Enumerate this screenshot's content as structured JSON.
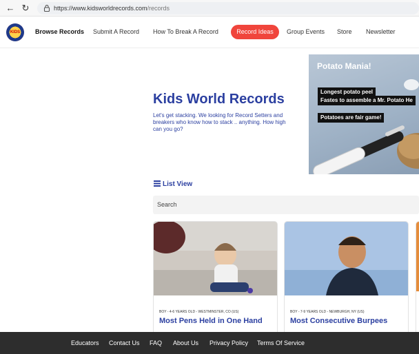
{
  "browser": {
    "url_host": "https://www.kidsworldrecords.com",
    "url_path": "/records"
  },
  "header": {
    "logo_text": "KIDS",
    "nav": [
      "Browse Records",
      "Submit A Record",
      "How To Break A Record",
      "Record Ideas",
      "Group Events",
      "Store",
      "Newsletter"
    ],
    "accent_color": "#f0453c"
  },
  "hero": {
    "title": "Kids World Records",
    "subtitle": "Let's get stacking. We looking for Record Setters and breakers who know how to stack .. anything. How high can you go?",
    "image": {
      "title": "Potato Mania!",
      "captions": [
        "Longest potato peel",
        "Fastes to assemble a Mr. Potato He",
        "Potatoes are fair game!"
      ]
    }
  },
  "list_view": {
    "label": "List View"
  },
  "search": {
    "placeholder": "Search"
  },
  "records": [
    {
      "meta": "BOY - 4-6 YEARS OLD - WESTMINSTER, CO (US)",
      "title": "Most Pens Held in One Hand"
    },
    {
      "meta": "BOY - 7-9 YEARS OLD - NEWBURGH, NY (US)",
      "title": "Most Consecutive Burpees"
    }
  ],
  "footer": {
    "links": [
      "Educators",
      "Contact Us",
      "FAQ",
      "About Us",
      "Privacy Policy",
      "Terms Of Service"
    ]
  }
}
